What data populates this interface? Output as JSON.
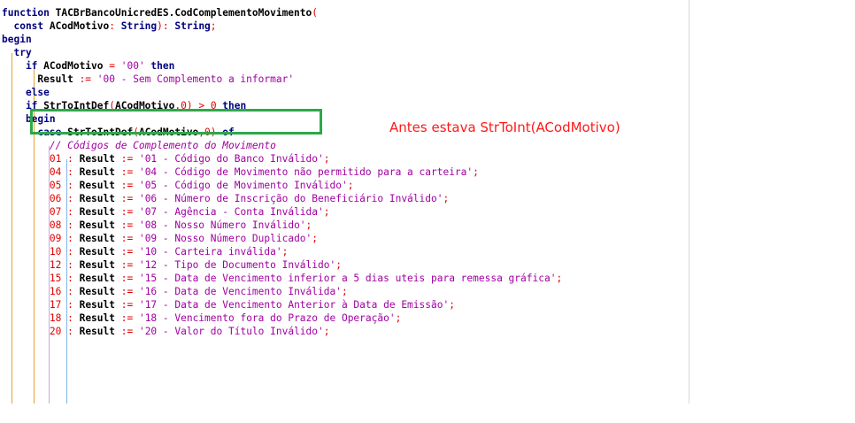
{
  "editor": {
    "lines": [
      [
        {
          "t": "function",
          "c": "kw"
        },
        {
          "t": " TACBrBancoUnicredES.CodComplementoMovimento",
          "c": "id"
        },
        {
          "t": "(",
          "c": "op"
        }
      ],
      [
        {
          "t": "  const",
          "c": "kw"
        },
        {
          "t": " ACodMotivo",
          "c": "id"
        },
        {
          "t": ": ",
          "c": "op"
        },
        {
          "t": "String",
          "c": "kw"
        },
        {
          "t": "): ",
          "c": "op"
        },
        {
          "t": "String",
          "c": "kw"
        },
        {
          "t": ";",
          "c": "op"
        }
      ],
      [
        {
          "t": "begin",
          "c": "kw"
        }
      ],
      [
        {
          "t": "  try",
          "c": "kw"
        }
      ],
      [
        {
          "t": "    if",
          "c": "kw"
        },
        {
          "t": " ACodMotivo ",
          "c": "id"
        },
        {
          "t": "=",
          "c": "op"
        },
        {
          "t": " '00'",
          "c": "str"
        },
        {
          "t": " then",
          "c": "kw"
        }
      ],
      [
        {
          "t": "      Result ",
          "c": "id"
        },
        {
          "t": ":=",
          "c": "op"
        },
        {
          "t": " '00 - Sem Complemento a informar'",
          "c": "str"
        }
      ],
      [
        {
          "t": "    else",
          "c": "kw"
        }
      ],
      [
        {
          "t": "    if",
          "c": "kw"
        },
        {
          "t": " StrToIntDef",
          "c": "id"
        },
        {
          "t": "(",
          "c": "op"
        },
        {
          "t": "ACodMotivo",
          "c": "id"
        },
        {
          "t": ",",
          "c": "op"
        },
        {
          "t": "0",
          "c": "num"
        },
        {
          "t": ") > ",
          "c": "op"
        },
        {
          "t": "0",
          "c": "num"
        },
        {
          "t": " then",
          "c": "kw"
        }
      ],
      [
        {
          "t": "    begin",
          "c": "kw"
        }
      ],
      [
        {
          "t": "      case",
          "c": "kw"
        },
        {
          "t": " StrToIntDef",
          "c": "id"
        },
        {
          "t": "(",
          "c": "op"
        },
        {
          "t": "ACodMotivo",
          "c": "id"
        },
        {
          "t": ",",
          "c": "op"
        },
        {
          "t": "0",
          "c": "num"
        },
        {
          "t": ")",
          "c": "op"
        },
        {
          "t": " of",
          "c": "kw"
        }
      ],
      [
        {
          "t": "        // Códigos de Complemento do Movimento",
          "c": "cmt"
        }
      ],
      [
        {
          "t": "        01",
          "c": "num"
        },
        {
          "t": " : ",
          "c": "op"
        },
        {
          "t": "Result ",
          "c": "id"
        },
        {
          "t": ":=",
          "c": "op"
        },
        {
          "t": " '01 - Código do Banco Inválido'",
          "c": "str"
        },
        {
          "t": ";",
          "c": "op"
        }
      ],
      [
        {
          "t": "        04",
          "c": "num"
        },
        {
          "t": " : ",
          "c": "op"
        },
        {
          "t": "Result ",
          "c": "id"
        },
        {
          "t": ":=",
          "c": "op"
        },
        {
          "t": " '04 - Código de Movimento não permitido para a carteira'",
          "c": "str"
        },
        {
          "t": ";",
          "c": "op"
        }
      ],
      [
        {
          "t": "        05",
          "c": "num"
        },
        {
          "t": " : ",
          "c": "op"
        },
        {
          "t": "Result ",
          "c": "id"
        },
        {
          "t": ":=",
          "c": "op"
        },
        {
          "t": " '05 - Código de Movimento Inválido'",
          "c": "str"
        },
        {
          "t": ";",
          "c": "op"
        }
      ],
      [
        {
          "t": "        06",
          "c": "num"
        },
        {
          "t": " : ",
          "c": "op"
        },
        {
          "t": "Result ",
          "c": "id"
        },
        {
          "t": ":=",
          "c": "op"
        },
        {
          "t": " '06 - Número de Inscrição do Beneficiário Inválido'",
          "c": "str"
        },
        {
          "t": ";",
          "c": "op"
        }
      ],
      [
        {
          "t": "        07",
          "c": "num"
        },
        {
          "t": " : ",
          "c": "op"
        },
        {
          "t": "Result ",
          "c": "id"
        },
        {
          "t": ":=",
          "c": "op"
        },
        {
          "t": " '07 - Agência - Conta Inválida'",
          "c": "str"
        },
        {
          "t": ";",
          "c": "op"
        }
      ],
      [
        {
          "t": "        08",
          "c": "num"
        },
        {
          "t": " : ",
          "c": "op"
        },
        {
          "t": "Result ",
          "c": "id"
        },
        {
          "t": ":=",
          "c": "op"
        },
        {
          "t": " '08 - Nosso Número Inválido'",
          "c": "str"
        },
        {
          "t": ";",
          "c": "op"
        }
      ],
      [
        {
          "t": "        09",
          "c": "num"
        },
        {
          "t": " : ",
          "c": "op"
        },
        {
          "t": "Result ",
          "c": "id"
        },
        {
          "t": ":=",
          "c": "op"
        },
        {
          "t": " '09 - Nosso Número Duplicado'",
          "c": "str"
        },
        {
          "t": ";",
          "c": "op"
        }
      ],
      [
        {
          "t": "        10",
          "c": "num"
        },
        {
          "t": " : ",
          "c": "op"
        },
        {
          "t": "Result ",
          "c": "id"
        },
        {
          "t": ":=",
          "c": "op"
        },
        {
          "t": " '10 - Carteira inválida'",
          "c": "str"
        },
        {
          "t": ";",
          "c": "op"
        }
      ],
      [
        {
          "t": "        12",
          "c": "num"
        },
        {
          "t": " : ",
          "c": "op"
        },
        {
          "t": "Result ",
          "c": "id"
        },
        {
          "t": ":=",
          "c": "op"
        },
        {
          "t": " '12 - Tipo de Documento Inválido'",
          "c": "str"
        },
        {
          "t": ";",
          "c": "op"
        }
      ],
      [
        {
          "t": "        15",
          "c": "num"
        },
        {
          "t": " : ",
          "c": "op"
        },
        {
          "t": "Result ",
          "c": "id"
        },
        {
          "t": ":=",
          "c": "op"
        },
        {
          "t": " '15 - Data de Vencimento inferior a 5 dias uteis para remessa gráfica'",
          "c": "str"
        },
        {
          "t": ";",
          "c": "op"
        }
      ],
      [
        {
          "t": "        16",
          "c": "num"
        },
        {
          "t": " : ",
          "c": "op"
        },
        {
          "t": "Result ",
          "c": "id"
        },
        {
          "t": ":=",
          "c": "op"
        },
        {
          "t": " '16 - Data de Vencimento Inválida'",
          "c": "str"
        },
        {
          "t": ";",
          "c": "op"
        }
      ],
      [
        {
          "t": "        17",
          "c": "num"
        },
        {
          "t": " : ",
          "c": "op"
        },
        {
          "t": "Result ",
          "c": "id"
        },
        {
          "t": ":=",
          "c": "op"
        },
        {
          "t": " '17 - Data de Vencimento Anterior à Data de Emissão'",
          "c": "str"
        },
        {
          "t": ";",
          "c": "op"
        }
      ],
      [
        {
          "t": "        18",
          "c": "num"
        },
        {
          "t": " : ",
          "c": "op"
        },
        {
          "t": "Result ",
          "c": "id"
        },
        {
          "t": ":=",
          "c": "op"
        },
        {
          "t": " '18 - Vencimento fora do Prazo de Operação'",
          "c": "str"
        },
        {
          "t": ";",
          "c": "op"
        }
      ],
      [
        {
          "t": "        20",
          "c": "num"
        },
        {
          "t": " : ",
          "c": "op"
        },
        {
          "t": "Result ",
          "c": "id"
        },
        {
          "t": ":=",
          "c": "op"
        },
        {
          "t": " '20 - Valor do Título Inválido'",
          "c": "str"
        },
        {
          "t": ";",
          "c": "op"
        }
      ]
    ]
  },
  "annotation": "Antes estava StrToInt(ACodMotivo)",
  "colors": {
    "highlight_box": "#2ea84a",
    "annotation": "#ff1a1a",
    "keyword": "#000080",
    "string": "#a000a0",
    "number": "#e00000"
  }
}
